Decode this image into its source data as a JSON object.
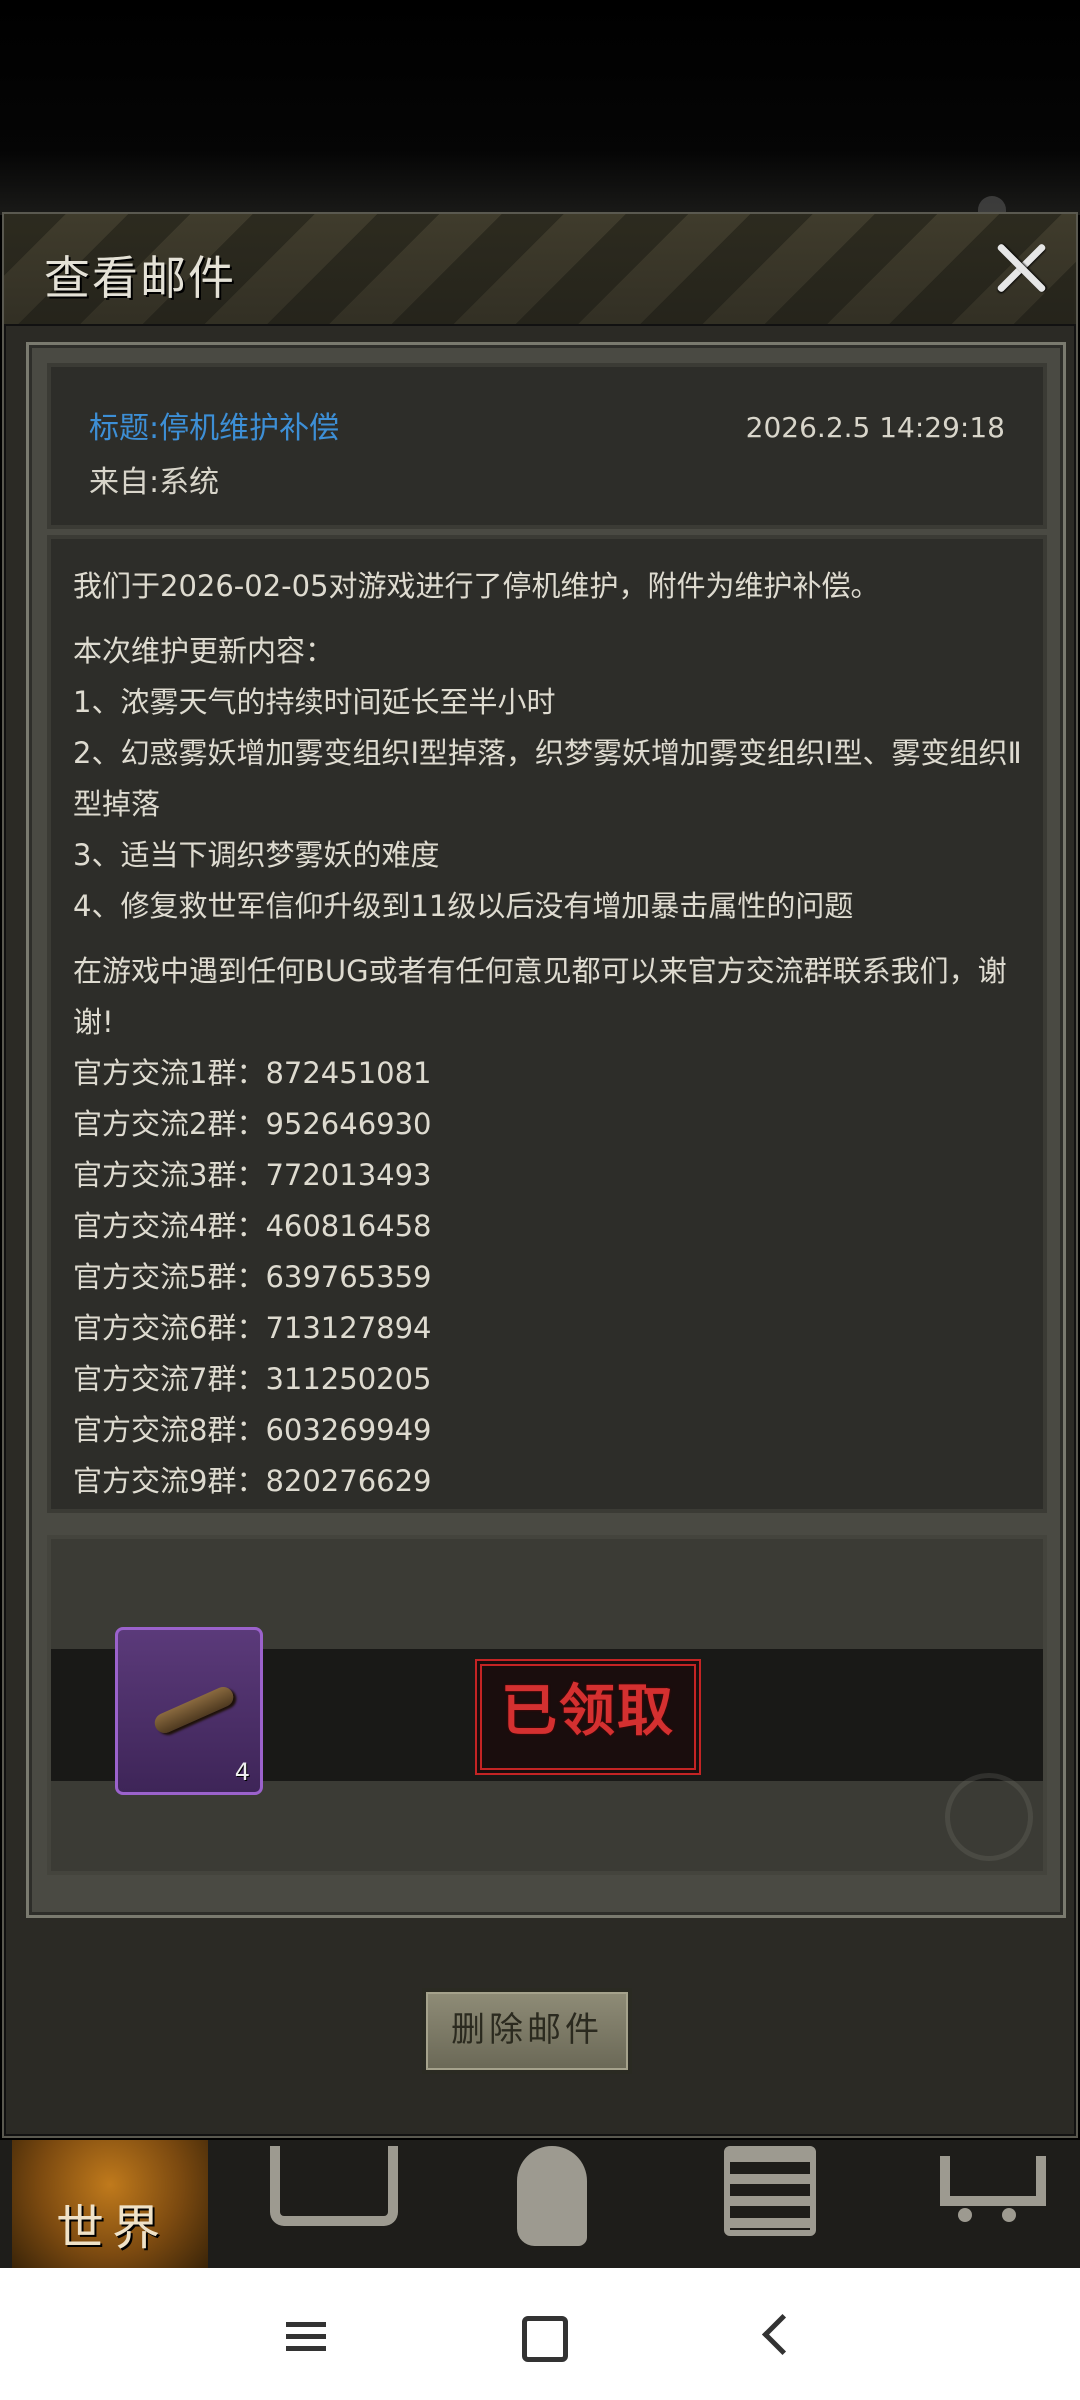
{
  "dialog": {
    "title": "查看邮件",
    "close_icon": "close-icon"
  },
  "mail": {
    "subject": "标题:停机维护补偿",
    "from": "来自:系统",
    "date": "2026.2.5 14:29:18",
    "body": {
      "intro": "我们于2026-02-05对游戏进行了停机维护，附件为维护补偿。",
      "update_title": "本次维护更新内容：",
      "updates": [
        "1、浓雾天气的持续时间延长至半小时",
        "2、幻惑雾妖增加雾变组织Ⅰ型掉落，织梦雾妖增加雾变组织Ⅰ型、雾变组织Ⅱ型掉落",
        "3、适当下调织梦雾妖的难度",
        "4、修复救世军信仰升级到11级以后没有增加暴击属性的问题"
      ],
      "contact": "在游戏中遇到任何BUG或者有任何意见都可以来官方交流群联系我们，谢谢!",
      "groups": [
        "官方交流1群：872451081",
        "官方交流2群：952646930",
        "官方交流3群：772013493",
        "官方交流4群：460816458",
        "官方交流5群：639765359",
        "官方交流6群：713127894",
        "官方交流7群：311250205",
        "官方交流8群：603269949",
        "官方交流9群：820276629"
      ]
    }
  },
  "attachment": {
    "item_icon": "wooden-stick-icon",
    "count": "4",
    "status": "已领取"
  },
  "actions": {
    "delete_label": "删除邮件"
  },
  "game_nav": {
    "world_label": "世界",
    "icons": [
      "base-icon",
      "character-icon",
      "backpack-icon",
      "shop-cart-icon"
    ]
  },
  "colors": {
    "subject_blue": "#3d8fd6",
    "panel_bg": "#2d2d29",
    "stamp_red": "#d43030",
    "item_purple": "#9b62cc"
  }
}
